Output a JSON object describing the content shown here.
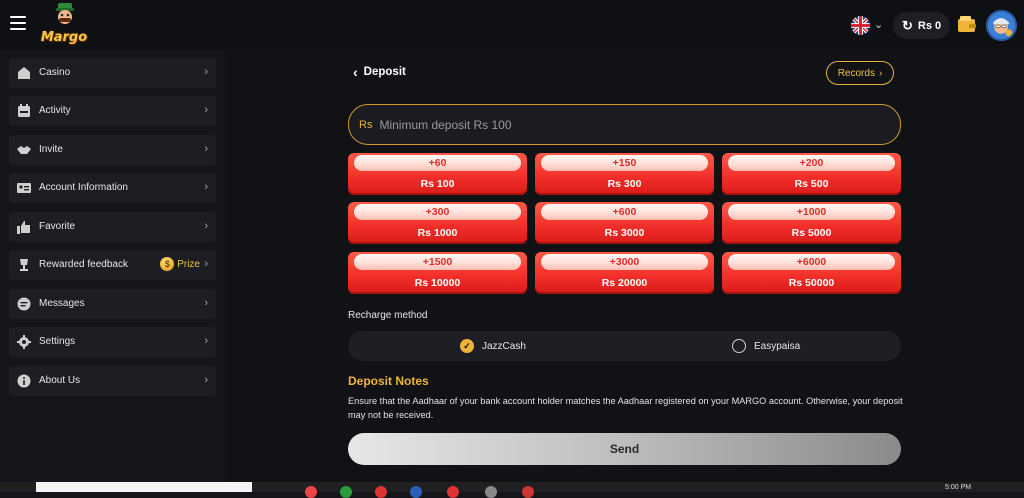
{
  "header": {
    "menu_icon": "hamburger-menu-icon",
    "logo_text": "Margo",
    "language_icon": "uk-flag-icon",
    "balance": "Rs 0",
    "refresh_icon": "refresh-icon",
    "wallet_icon": "wallet-icon",
    "avatar_icon": "user-avatar-icon"
  },
  "sidebar": {
    "items": [
      {
        "label": "Casino",
        "icon": "casino-icon"
      },
      {
        "label": "Activity",
        "icon": "calendar-icon"
      },
      {
        "label": "Invite",
        "icon": "handshake-icon"
      },
      {
        "label": "Account Information",
        "icon": "id-card-icon"
      },
      {
        "label": "Favorite",
        "icon": "thumbs-up-icon"
      },
      {
        "label": "Rewarded feedback",
        "icon": "trophy-icon",
        "badge": "Prize"
      },
      {
        "label": "Messages",
        "icon": "chat-icon"
      },
      {
        "label": "Settings",
        "icon": "gear-icon"
      },
      {
        "label": "About Us",
        "icon": "info-icon"
      }
    ]
  },
  "deposit": {
    "title": "Deposit",
    "records_label": "Records",
    "currency_symbol": "Rs",
    "placeholder": "Minimum deposit Rs 100",
    "amounts": [
      {
        "bonus": "+60",
        "value": "Rs 100"
      },
      {
        "bonus": "+150",
        "value": "Rs 300"
      },
      {
        "bonus": "+200",
        "value": "Rs 500"
      },
      {
        "bonus": "+300",
        "value": "Rs 1000"
      },
      {
        "bonus": "+600",
        "value": "Rs 3000"
      },
      {
        "bonus": "+1000",
        "value": "Rs 5000"
      },
      {
        "bonus": "+1500",
        "value": "Rs 10000"
      },
      {
        "bonus": "+3000",
        "value": "Rs 20000"
      },
      {
        "bonus": "+6000",
        "value": "Rs 50000"
      }
    ],
    "recharge_label": "Recharge method",
    "methods": [
      {
        "label": "JazzCash",
        "selected": true
      },
      {
        "label": "Easypaisa",
        "selected": false
      }
    ],
    "notes_title": "Deposit Notes",
    "notes_text": "Ensure that the Aadhaar of your bank account holder matches the Aadhaar registered on your MARGO account. Otherwise, your deposit may not be received.",
    "send_label": "Send"
  },
  "taskbar": {
    "clock": "5:00 PM"
  },
  "colors": {
    "accent_gold": "#f0b33a",
    "button_red": "#f12d28",
    "background": "#111216"
  }
}
